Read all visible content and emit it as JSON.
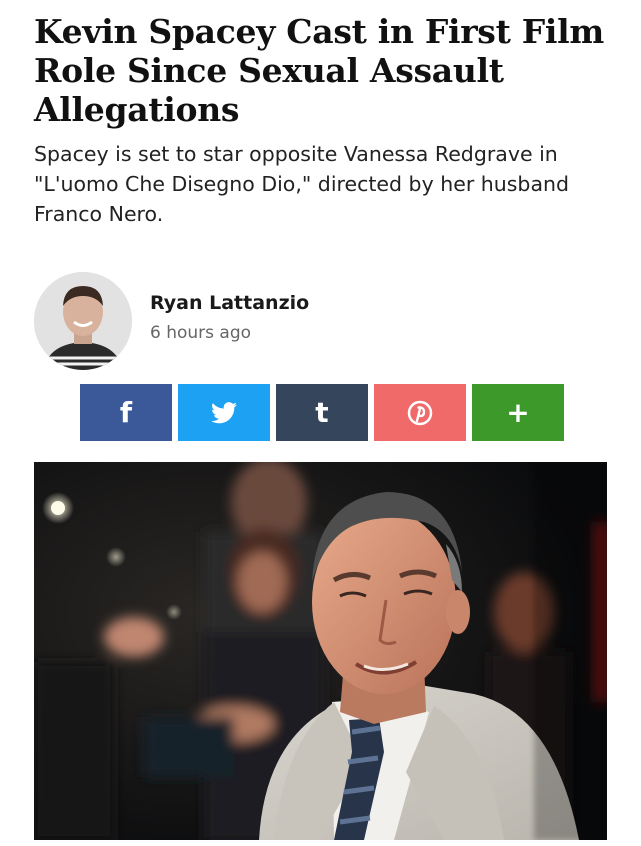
{
  "article": {
    "headline": "Kevin Spacey Cast in First Film Role Since Sexual Assault Allegations",
    "subtitle": "Spacey is set to star opposite Vanessa Redgrave in \"L'uomo Che Disegno Dio,\" directed by her husband Franco Nero."
  },
  "author": {
    "name": "Ryan Lattanzio",
    "time": "6 hours ago"
  },
  "share": [
    {
      "network": "facebook",
      "glyph": "f",
      "color": "#3b5998"
    },
    {
      "network": "twitter",
      "glyph": "twitter-bird",
      "color": "#1da1f2"
    },
    {
      "network": "tumblr",
      "glyph": "t",
      "color": "#35465c"
    },
    {
      "network": "pinterest",
      "glyph": "P",
      "color": "#f16a6a"
    },
    {
      "network": "more",
      "glyph": "+",
      "color": "#3d9a2a"
    }
  ],
  "hero_image": {
    "icon": "photo-of-man-in-suit"
  }
}
